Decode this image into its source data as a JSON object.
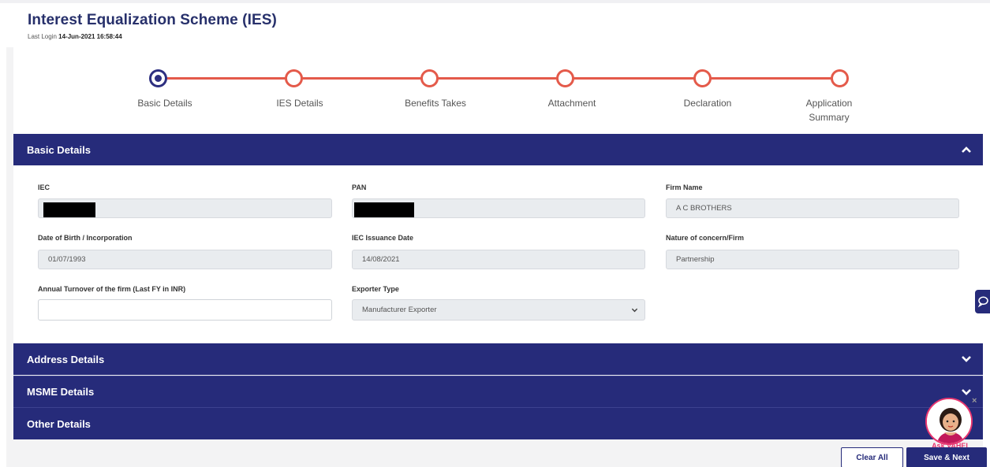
{
  "header": {
    "title": "Interest Equalization Scheme (IES)",
    "last_login_label": "Last Login",
    "last_login_value": "14-Jun-2021 16:58:44"
  },
  "stepper": {
    "steps": [
      {
        "label": "Basic Details",
        "active": true
      },
      {
        "label": "IES Details",
        "active": false
      },
      {
        "label": "Benefits Takes",
        "active": false
      },
      {
        "label": "Attachment",
        "active": false
      },
      {
        "label": "Declaration",
        "active": false
      },
      {
        "label": "Application Summary",
        "active": false
      }
    ]
  },
  "sections": {
    "basic": "Basic Details",
    "address": "Address Details",
    "msme": "MSME Details",
    "other": "Other Details"
  },
  "form": {
    "iec": {
      "label": "IEC",
      "value": ""
    },
    "pan": {
      "label": "PAN",
      "value": ""
    },
    "firm_name": {
      "label": "Firm Name",
      "value": "A C BROTHERS"
    },
    "dob": {
      "label": "Date of Birth / Incorporation",
      "value": "01/07/1993"
    },
    "iec_date": {
      "label": "IEC Issuance Date",
      "value": "14/08/2021"
    },
    "nature": {
      "label": "Nature of concern/Firm",
      "value": "Partnership"
    },
    "turnover": {
      "label": "Annual Turnover of the firm (Last FY in INR)",
      "value": ""
    },
    "exporter_type": {
      "label": "Exporter Type",
      "value": "Manufacturer Exporter"
    }
  },
  "actions": {
    "clear": "Clear All",
    "save": "Save & Next"
  },
  "assistant": {
    "label": "Ask VAHEI",
    "close": "×"
  },
  "colors": {
    "primary": "#262b7a",
    "step_line": "#e45a4a",
    "accent_pink": "#e8356f"
  },
  "icons": {
    "chat": "chat-icon",
    "chevron_up": "chevron-up-icon",
    "chevron_down": "chevron-down-icon"
  }
}
